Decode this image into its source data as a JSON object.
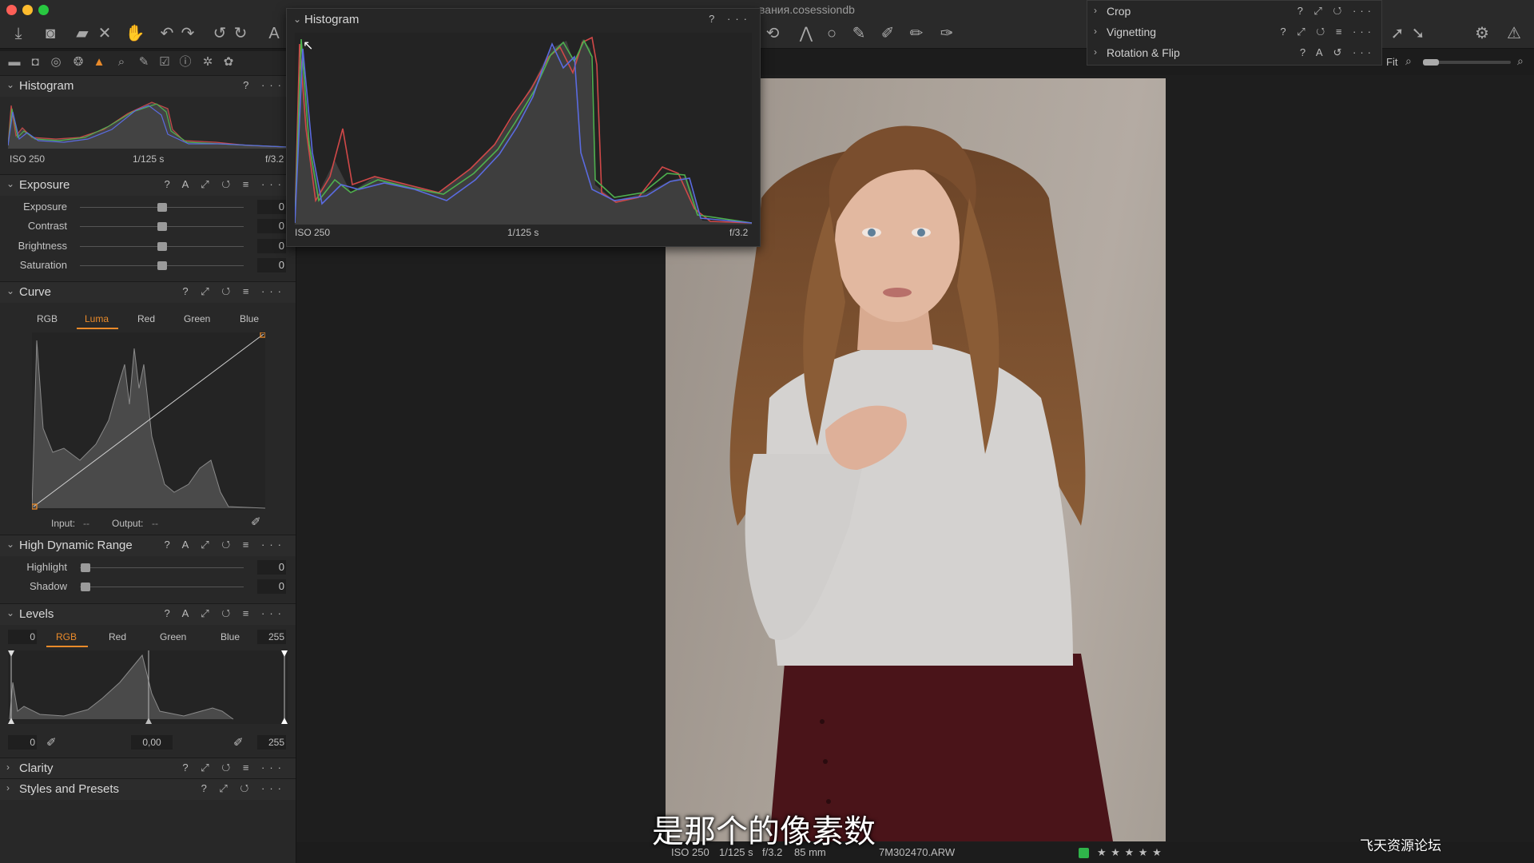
{
  "window": {
    "title_fragment": "вания.cosessiondb"
  },
  "histogram_panel": {
    "title": "Histogram",
    "iso": "ISO 250",
    "shutter": "1/125 s",
    "aperture": "f/3.2"
  },
  "histogram_popup": {
    "title": "Histogram",
    "iso": "ISO 250",
    "shutter": "1/125 s",
    "aperture": "f/3.2"
  },
  "exposure": {
    "title": "Exposure",
    "sliders": [
      {
        "label": "Exposure",
        "value": "0",
        "level": 0.5
      },
      {
        "label": "Contrast",
        "value": "0",
        "level": 0.5
      },
      {
        "label": "Brightness",
        "value": "0",
        "level": 0.5
      },
      {
        "label": "Saturation",
        "value": "0",
        "level": 0.5
      }
    ]
  },
  "curve": {
    "title": "Curve",
    "tabs": [
      "RGB",
      "Luma",
      "Red",
      "Green",
      "Blue"
    ],
    "active_tab": "Luma",
    "input_label": "Input:",
    "input_value": "--",
    "output_label": "Output:",
    "output_value": "--"
  },
  "hdr": {
    "title": "High Dynamic Range",
    "sliders": [
      {
        "label": "Highlight",
        "value": "0",
        "level": 0.0
      },
      {
        "label": "Shadow",
        "value": "0",
        "level": 0.0
      }
    ]
  },
  "levels": {
    "title": "Levels",
    "tabs": [
      "RGB",
      "Red",
      "Green",
      "Blue"
    ],
    "active_tab": "RGB",
    "top_left": "0",
    "top_right": "255",
    "bottom_left": "0",
    "midpoint": "0,00",
    "bottom_right": "255"
  },
  "clarity": {
    "title": "Clarity"
  },
  "styles": {
    "title": "Styles and Presets"
  },
  "tool_popup": {
    "items": [
      "Crop",
      "Vignetting",
      "Rotation & Flip"
    ]
  },
  "viewer": {
    "zoom_label": "Fit"
  },
  "status": {
    "iso": "ISO 250",
    "shutter": "1/125 s",
    "aperture": "f/3.2",
    "focal": "85 mm",
    "filename": "7M302470.ARW",
    "color_tag": "#2fb34a",
    "rating_stars": "★ ★ ★ ★ ★"
  },
  "subtitle": "是那个的像素数",
  "watermark": "飞天资源论坛"
}
